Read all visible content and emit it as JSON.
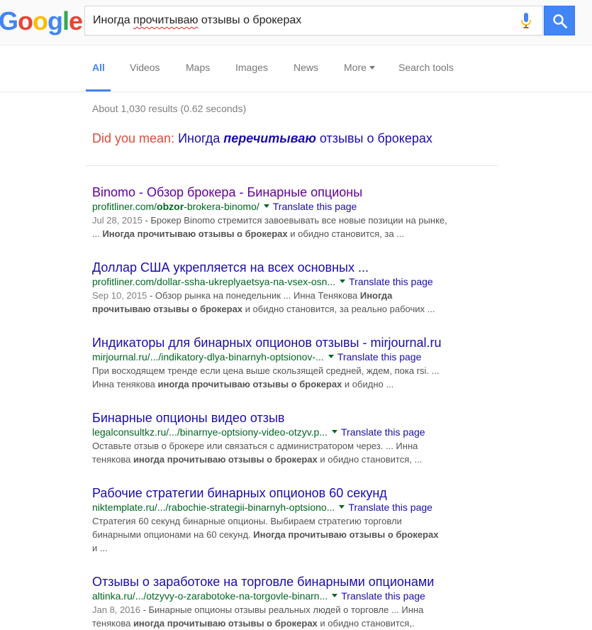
{
  "header": {
    "logo_letters": [
      {
        "ch": "G",
        "color": "#4285f4"
      },
      {
        "ch": "o",
        "color": "#ea4335"
      },
      {
        "ch": "o",
        "color": "#fbbc05"
      },
      {
        "ch": "g",
        "color": "#4285f4"
      },
      {
        "ch": "l",
        "color": "#34a853"
      },
      {
        "ch": "e",
        "color": "#ea4335"
      }
    ],
    "query_before": "Иногда ",
    "query_misspelled": "прочитываю",
    "query_after": " отзывы о брокерах",
    "mic_icon": "mic-icon",
    "search_icon": "search-icon"
  },
  "nav": {
    "tabs": [
      {
        "label": "All",
        "active": true
      },
      {
        "label": "Videos"
      },
      {
        "label": "Maps"
      },
      {
        "label": "Images"
      },
      {
        "label": "News"
      },
      {
        "label": "More"
      },
      {
        "label": "Search tools"
      }
    ]
  },
  "stats": "About 1,030 results (0.62 seconds)",
  "did_you_mean": {
    "label": "Did you mean:",
    "pre": "Иногда ",
    "bold": "перечитываю",
    "post": " отзывы о брокерах"
  },
  "colors": {
    "link": "#1a0dab",
    "visited": "#660099",
    "url": "#006621",
    "accent": "#4285f4",
    "dym_red": "#dd4b39"
  },
  "results": [
    {
      "title": "Binomo - Обзор брокера - Бинарные опционы",
      "visited": true,
      "url_pre": "profitliner.com/",
      "url_bold": "obzor",
      "url_post": "-brokera-binomo/",
      "translate": "Translate this page",
      "date": "Jul 28, 2015",
      "line1": " - Брокер Binomo стремится завоевывать все новые позиции на рынке,",
      "line2_pre": "... ",
      "line2_bold": "Иногда прочитываю отзывы о брокерах",
      "line2_post": " и обидно становится, за ..."
    },
    {
      "title": "Доллар США укрепляется на всех основных ...",
      "visited": false,
      "url_pre": "profitliner.com/dollar-ssha-ukreplyaetsya-na-vsex-osn...",
      "url_bold": "",
      "url_post": "",
      "translate": "Translate this page",
      "date": "Sep 10, 2015",
      "line1": " - Обзор рынка на понедельник ... Инна Тенякова ",
      "line1_bold": "Иногда",
      "line2_pre": "",
      "line2_bold": "прочитываю отзывы о брокерах",
      "line2_post": " и обидно становится, за реально рабочих ..."
    },
    {
      "title": "Индикаторы для бинарных опционов отзывы - mirjournal.ru",
      "visited": false,
      "url_pre": "mirjournal.ru/.../indikatory-dlya-binarnyh-optsionov-...",
      "url_bold": "",
      "url_post": "",
      "translate": "Translate this page",
      "date": "",
      "line1": "При восходящем тренде если цена выше скользящей средней, ждем, пока rsi. ...",
      "line2_pre": "Инна тенякова ",
      "line2_bold": "иногда прочитываю отзывы о брокерах",
      "line2_post": " и обидно ..."
    },
    {
      "title": "Бинарные опционы видео отзыв",
      "visited": false,
      "url_pre": "legalconsultkz.ru/.../binarnye-optsiony-video-otzyv.p...",
      "url_bold": "",
      "url_post": "",
      "translate": "Translate this page",
      "date": "",
      "line1": "Оставьте отзыв о брокере или связаться с администратором через. ... Инна",
      "line2_pre": "тенякова ",
      "line2_bold": "иногда прочитываю отзывы о брокерах",
      "line2_post": " и обидно становится, ..."
    },
    {
      "title": "Рабочие стратегии бинарных опционов 60 секунд",
      "visited": false,
      "url_pre": "niktemplate.ru/.../rabochie-strategii-binarnyh-optsiono...",
      "url_bold": "",
      "url_post": "",
      "translate": "Translate this page",
      "date": "",
      "line1": "Стратегия 60 секунд бинарные опционы. Выбираем стратегию торговли",
      "line2_pre": "бинарными опционами на 60 секунд. ",
      "line2_bold": "Иногда прочитываю отзывы о брокерах",
      "line2_post": "",
      "line3": "и ..."
    },
    {
      "title": "Отзывы о заработоке на торговле бинарными опционами",
      "visited": false,
      "url_pre": "altinka.ru/.../otzyvy-o-zarabotoke-na-torgovle-binarn...",
      "url_bold": "",
      "url_post": "",
      "translate": "Translate this page",
      "date": "Jan 8, 2016",
      "line1": " - Бинарные опционы отзывы реальных людей о торговле ... Инна",
      "line2_pre": "тенякова ",
      "line2_bold": "иногда прочитываю отзывы о брокерах",
      "line2_post": " и обидно становится,."
    }
  ]
}
